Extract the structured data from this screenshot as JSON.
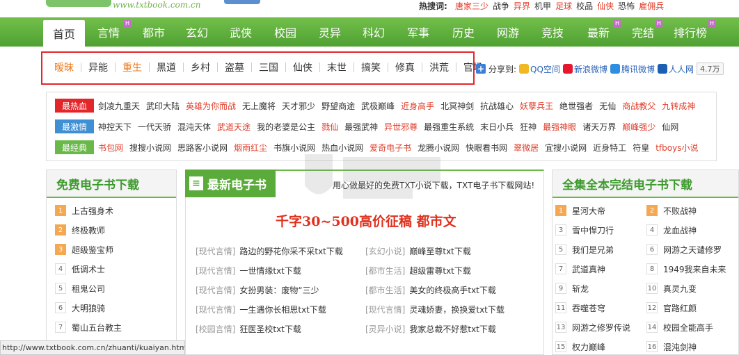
{
  "header": {
    "site_url": "www.txtbook.com.cn",
    "hot_label": "热搜词:",
    "hot_words": [
      "唐家三少",
      "战争",
      "异界",
      "机甲",
      "足球",
      "校品",
      "仙侠",
      "恐怖",
      "雇佣兵"
    ]
  },
  "nav": [
    {
      "label": "首页",
      "active": true,
      "badge": ""
    },
    {
      "label": "言情",
      "badge": "H"
    },
    {
      "label": "都市",
      "badge": ""
    },
    {
      "label": "玄幻",
      "badge": ""
    },
    {
      "label": "武侠",
      "badge": ""
    },
    {
      "label": "校园",
      "badge": ""
    },
    {
      "label": "灵异",
      "badge": ""
    },
    {
      "label": "科幻",
      "badge": ""
    },
    {
      "label": "军事",
      "badge": ""
    },
    {
      "label": "历史",
      "badge": ""
    },
    {
      "label": "网游",
      "badge": ""
    },
    {
      "label": "竞技",
      "badge": ""
    },
    {
      "label": "最新",
      "badge": "H"
    },
    {
      "label": "完结",
      "badge": "H"
    },
    {
      "label": "排行榜",
      "badge": "H"
    }
  ],
  "tags": [
    {
      "label": "暧昧",
      "orange": true
    },
    {
      "label": "异能"
    },
    {
      "label": "重生",
      "orange": true
    },
    {
      "label": "黑道"
    },
    {
      "label": "乡村"
    },
    {
      "label": "盗墓"
    },
    {
      "label": "三国"
    },
    {
      "label": "仙侠"
    },
    {
      "label": "末世"
    },
    {
      "label": "搞笑"
    },
    {
      "label": "修真"
    },
    {
      "label": "洪荒"
    },
    {
      "label": "官场"
    }
  ],
  "share": {
    "label": "分享到:",
    "items": [
      "QQ空间",
      "新浪微博",
      "腾讯微博",
      "人人网"
    ],
    "count": "4.7万"
  },
  "hot_rows": [
    {
      "badge": "最热血",
      "color": "#e3262a",
      "links": [
        {
          "t": "剑凌九重天"
        },
        {
          "t": "武印大陆"
        },
        {
          "t": "英雄为你而战",
          "red": true
        },
        {
          "t": "无上魔将"
        },
        {
          "t": "天才邪少"
        },
        {
          "t": "野望商途"
        },
        {
          "t": "武极巅峰"
        },
        {
          "t": "近身高手",
          "red": true
        },
        {
          "t": "北冥神剑"
        },
        {
          "t": "抗战雄心"
        },
        {
          "t": "妖孽兵王",
          "red": true
        },
        {
          "t": "绝世强者"
        },
        {
          "t": "无仙"
        },
        {
          "t": "商战教父",
          "red": true
        },
        {
          "t": "九转成神",
          "red": true
        }
      ]
    },
    {
      "badge": "最激情",
      "color": "#3e8fd3",
      "links": [
        {
          "t": "神控天下"
        },
        {
          "t": "一代天骄"
        },
        {
          "t": "混沌天体"
        },
        {
          "t": "武道天途",
          "red": true
        },
        {
          "t": "我的老婆是公主"
        },
        {
          "t": "戮仙",
          "red": true
        },
        {
          "t": "最强武神"
        },
        {
          "t": "异世邪尊",
          "red": true
        },
        {
          "t": "最强重生系统"
        },
        {
          "t": "末日小兵"
        },
        {
          "t": "狂神"
        },
        {
          "t": "最强神眼",
          "red": true
        },
        {
          "t": "诸天万界"
        },
        {
          "t": "巅峰强少",
          "red": true
        },
        {
          "t": "仙网"
        }
      ]
    },
    {
      "badge": "最经典",
      "color": "#6ab84a",
      "links": [
        {
          "t": "书包网",
          "red": true
        },
        {
          "t": "搜搜小说网"
        },
        {
          "t": "思路客小说网"
        },
        {
          "t": "烟雨红尘",
          "red": true
        },
        {
          "t": "书旗小说网"
        },
        {
          "t": "热血小说网"
        },
        {
          "t": "爱奇电子书",
          "red": true
        },
        {
          "t": "龙腾小说网"
        },
        {
          "t": "快眼看书网"
        },
        {
          "t": "翠微居",
          "red": true
        },
        {
          "t": "宜搜小说网"
        },
        {
          "t": "近身特工"
        },
        {
          "t": "符皇"
        },
        {
          "t": "tfboys小说",
          "red": true
        }
      ]
    }
  ],
  "left_panel": {
    "title": "免费电子书下载",
    "items": [
      "上古强身术",
      "终极教师",
      "超级鉴宝师",
      "低调术士",
      "租鬼公司",
      "大明狼骑",
      "蜀山五台教主"
    ]
  },
  "center_panel": {
    "title": "最新电子书",
    "slogan": "用心做最好的免费TXT小说下载，TXT电子书下载网站!",
    "headline": "千字30~500高价征稿  都市文",
    "col1": [
      {
        "cat": "[现代言情]",
        "t": "路边的野花你采不采txt下载"
      },
      {
        "cat": "[现代言情]",
        "t": "一世情缘txt下载"
      },
      {
        "cat": "[现代言情]",
        "t": "女扮男装：废物“三少"
      },
      {
        "cat": "[现代言情]",
        "t": "一生遇你长相思txt下载"
      },
      {
        "cat": "[校园言情]",
        "t": "狂医圣校txt下载"
      }
    ],
    "col2": [
      {
        "cat": "[玄幻小说]",
        "t": "巅峰至尊txt下载"
      },
      {
        "cat": "[都市生活]",
        "t": "超级雷尊txt下载"
      },
      {
        "cat": "[都市生活]",
        "t": "美女的终极高手txt下载"
      },
      {
        "cat": "[现代言情]",
        "t": "灵魂娇妻，换换爱txt下载"
      },
      {
        "cat": "[灵异小说]",
        "t": "我家总裁不好惹txt下载"
      }
    ]
  },
  "right_panel": {
    "title": "全集全本完结电子书下载",
    "col1": [
      "星河大帝",
      "雪中悍刀行",
      "我们是兄弟",
      "武道真神",
      "斩龙",
      "吞噬苍穹",
      "网游之修罗传说",
      "权力巅峰"
    ],
    "col2": [
      "不败战神",
      "龙血战神",
      "网游之天谴修罗",
      "1949我来自未来",
      "真灵九变",
      "官路红颜",
      "校园全能高手",
      "混沌剑神"
    ]
  },
  "status_url": "http://www.txtbook.com.cn/zhuanti/kuaiyan.htm"
}
